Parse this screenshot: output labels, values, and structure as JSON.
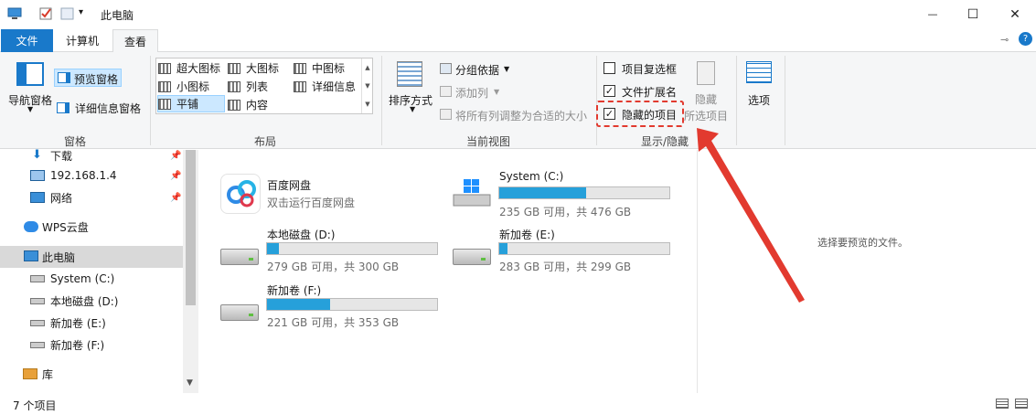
{
  "window": {
    "title": "此电脑",
    "quick_access_dropdown": "▾",
    "minimize": "—",
    "maximize": "☐",
    "close": "✕"
  },
  "tabs": [
    {
      "label": "文件",
      "active": false
    },
    {
      "label": "计算机",
      "active": false
    },
    {
      "label": "查看",
      "active": true
    }
  ],
  "ribbon": {
    "pane_group": {
      "nav_pane": "导航窗格",
      "preview_pane": "预览窗格",
      "details_pane": "详细信息窗格",
      "label": "窗格"
    },
    "layout_group": {
      "items": [
        "超大图标",
        "大图标",
        "中图标",
        "小图标",
        "列表",
        "详细信息",
        "平铺",
        "内容"
      ],
      "selected": "平铺",
      "label": "布局"
    },
    "current_view_group": {
      "sort_by": "排序方式",
      "group_by": "分组依据",
      "add_columns": "添加列",
      "size_all_columns": "将所有列调整为合适的大小",
      "label": "当前视图"
    },
    "show_hide_group": {
      "item_checkboxes": {
        "label": "项目复选框",
        "checked": false
      },
      "file_extensions": {
        "label": "文件扩展名",
        "checked": true
      },
      "hidden_items": {
        "label": "隐藏的项目",
        "checked": true
      },
      "hide_selected": "隐藏",
      "hide_selected_sub": "所选项目",
      "label": "显示/隐藏"
    },
    "options": "选项"
  },
  "nav_pane": {
    "items": [
      {
        "label": "下载",
        "pinned": true
      },
      {
        "label": "192.168.1.4",
        "pinned": true
      },
      {
        "label": "网络",
        "pinned": true
      },
      {
        "label": "WPS云盘",
        "pinned": false
      },
      {
        "label": "此电脑",
        "selected": true
      },
      {
        "label": "System (C:)"
      },
      {
        "label": "本地磁盘 (D:)"
      },
      {
        "label": "新加卷 (E:)"
      },
      {
        "label": "新加卷 (F:)"
      },
      {
        "label": "库"
      }
    ]
  },
  "content": {
    "baidu": {
      "name": "百度网盘",
      "desc": "双击运行百度网盘"
    },
    "drives": [
      {
        "name": "System (C:)",
        "free": "235 GB 可用，共 476 GB",
        "used_fraction": 0.51
      },
      {
        "name": "本地磁盘 (D:)",
        "free": "279 GB 可用，共 300 GB",
        "used_fraction": 0.07
      },
      {
        "name": "新加卷 (E:)",
        "free": "283 GB 可用，共 299 GB",
        "used_fraction": 0.05
      },
      {
        "name": "新加卷 (F:)",
        "free": "221 GB 可用，共 353 GB",
        "used_fraction": 0.37
      }
    ]
  },
  "preview": {
    "text": "选择要预览的文件。"
  },
  "status": {
    "count": "7 个项目"
  },
  "colors": {
    "accent": "#1979ca",
    "bar": "#26a0da",
    "annotation": "#e23a2f"
  }
}
